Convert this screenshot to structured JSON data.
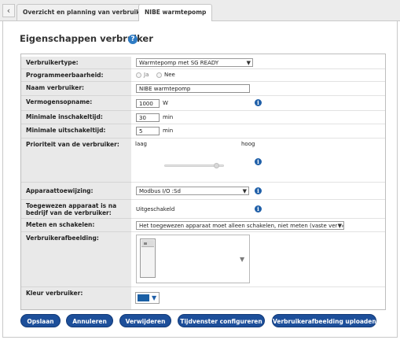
{
  "tabs": [
    {
      "label": "Overzicht en planning van verbruikers"
    },
    {
      "label": "NIBE warmtepomp"
    }
  ],
  "icons": {
    "back": "chevron-left-icon",
    "help": "help-circle-icon",
    "info": "info-icon"
  },
  "colors": {
    "primary_button": "#1d4f9a",
    "info_icon": "#1f5fa8",
    "consumer_color": "#1a5fa5"
  },
  "page": {
    "title": "Eigenschappen verbruiker",
    "help_glyph": "?"
  },
  "form": {
    "type": {
      "label": "Verbruikertype:",
      "value": "Warmtepomp met SG READY"
    },
    "programmable": {
      "label": "Programmeerbaarheid:",
      "option_yes": "Ja",
      "option_no": "Nee"
    },
    "name": {
      "label": "Naam verbruiker:",
      "value": "NIBE warmtepomp"
    },
    "power": {
      "label": "Vermogensopname:",
      "value": "1000",
      "unit": "W"
    },
    "min_on": {
      "label": "Minimale inschakeltijd:",
      "value": "30",
      "unit": "min"
    },
    "min_off": {
      "label": "Minimale uitschakeltijd:",
      "value": "5",
      "unit": "min"
    },
    "priority": {
      "label": "Prioriteit van de verbruiker:",
      "low": "laag",
      "high": "hoog",
      "level": 0.88
    },
    "device_assignment": {
      "label": "Apparaattoewijzing:",
      "value": "Modbus I/O :Sd"
    },
    "after_operation": {
      "label": "Toegewezen apparaat is na bedrijf van de verbruiker:",
      "value": "Uitgeschakeld"
    },
    "measure_switch": {
      "label": "Meten en schakelen:",
      "value": "Het toegewezen apparaat moet alleen schakelen, niet meten (vaste vermogensopname)"
    },
    "image": {
      "label": "Verbruikerafbeelding:"
    },
    "color": {
      "label": "Kleur verbruiker:"
    }
  },
  "buttons": {
    "save": "Opslaan",
    "cancel": "Annuleren",
    "delete": "Verwijderen",
    "time_window": "Tijdvenster configureren",
    "upload_image": "Verbruikerafbeelding uploaden"
  },
  "info_glyph": "i",
  "caret_glyph": "▼"
}
